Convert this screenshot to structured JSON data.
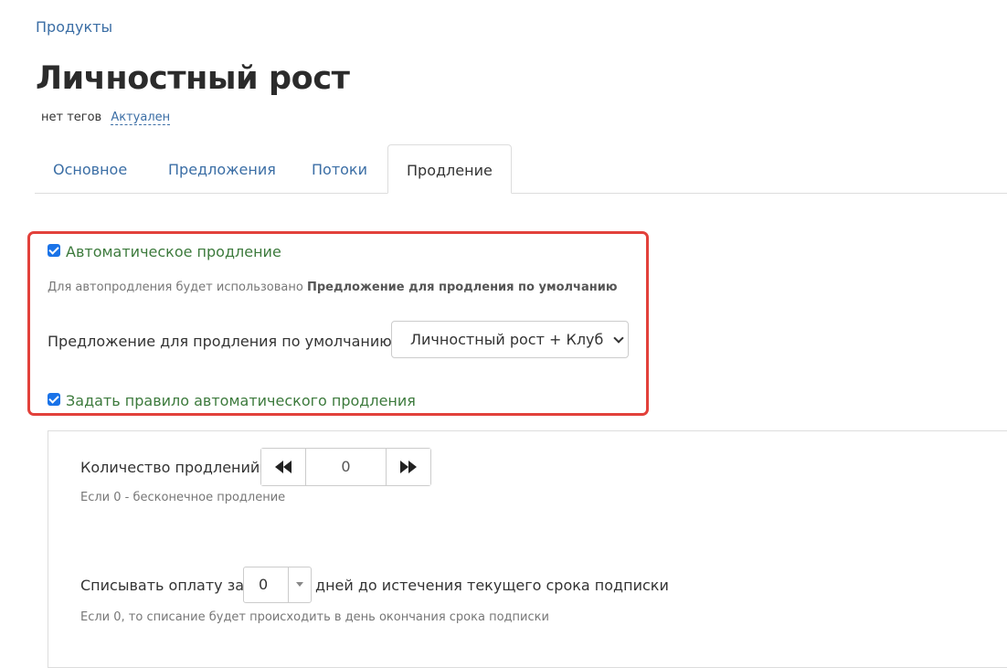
{
  "breadcrumb": "Продукты",
  "title": "Личностный рост",
  "tags": {
    "no_tags": "нет тегов",
    "status": "Актуален"
  },
  "tabs": [
    {
      "label": "Основное",
      "active": false
    },
    {
      "label": "Предложения",
      "active": false
    },
    {
      "label": "Потоки",
      "active": false
    },
    {
      "label": "Продление",
      "active": true
    }
  ],
  "renewal": {
    "auto_renew_label": "Автоматическое продление",
    "auto_renew_checked": true,
    "hint_prefix": "Для автопродления будет использовано",
    "hint_bold": "Предложение для продления по умолчанию",
    "default_offer_label": "Предложение для продления по умолчанию:",
    "default_offer_value": "Личностный рост + Клуб",
    "rule_label": "Задать правило автоматического продления",
    "rule_checked": true
  },
  "rule": {
    "count_label": "Количество продлений",
    "count_value": "0",
    "count_hint": "Если 0 - бесконечное продление",
    "charge_prefix": "Списывать оплату за",
    "charge_value": "0",
    "charge_suffix": "дней до истечения текущего срока подписки",
    "charge_hint": "Если 0, то списание будет происходить в день окончания срока подписки"
  },
  "colors": {
    "link": "#3b6ea5",
    "checkbox": "#1a73e8",
    "highlight": "#e2413b",
    "check_label": "#3c7a3c"
  }
}
